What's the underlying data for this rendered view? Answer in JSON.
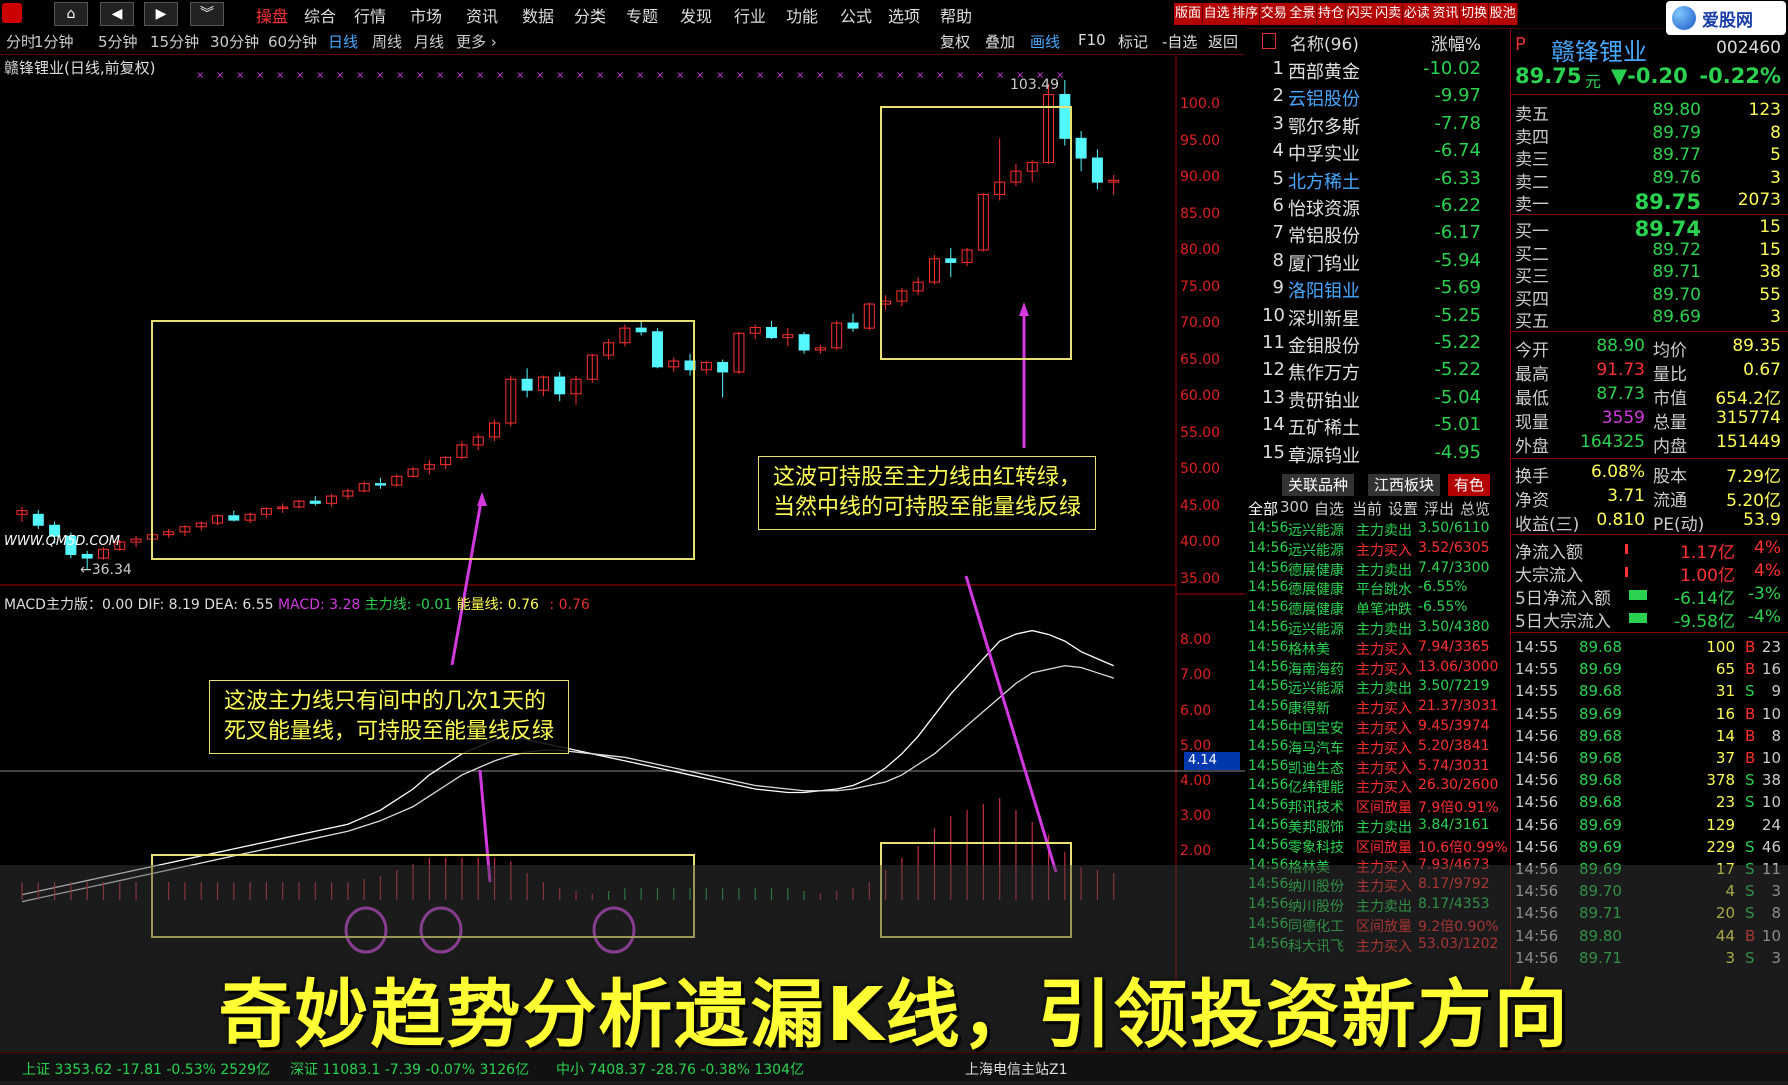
{
  "menubar": {
    "items": [
      "操盘",
      "综合",
      "行情",
      "市场",
      "资讯",
      "数据",
      "分类",
      "专题",
      "发现",
      "行业",
      "功能",
      "公式",
      "选项",
      "帮助"
    ],
    "active": "操盘",
    "right_buttons": [
      "版面",
      "自选",
      "排序",
      "交易",
      "全景",
      "持仓",
      "闪买",
      "闪卖",
      "必读",
      "资讯",
      "切换",
      "股池"
    ],
    "logo": "爱股网"
  },
  "periodbar": {
    "periods": [
      "分时",
      "1分钟",
      "5分钟",
      "15分钟",
      "30分钟",
      "60分钟",
      "日线",
      "周线",
      "月线",
      "更多 ›"
    ],
    "active": "日线",
    "tools": [
      "复权",
      "叠加",
      "画线",
      "F10",
      "标记",
      "-自选",
      "返回"
    ],
    "active_tool": "画线"
  },
  "chart": {
    "title": "赣锋锂业(日线,前复权)",
    "watermark": "WWW.QM5D.COM",
    "high_label": "103.49",
    "low_label": "36.34",
    "price_axis": [
      "100.0",
      "95.00",
      "90.00",
      "85.00",
      "80.00",
      "75.00",
      "70.00",
      "65.00",
      "60.00",
      "55.00",
      "50.00",
      "45.00",
      "40.00",
      "35.00"
    ],
    "macd_axis": [
      "8.00",
      "7.00",
      "6.00",
      "5.00",
      "4.00",
      "3.00",
      "2.00"
    ],
    "cursor_value": "4.14",
    "macd_header": {
      "name": "MACD主力版：0.00",
      "dif": "DIF: 8.19",
      "dea": "DEA: 6.55",
      "macd": "MACD: 3.28",
      "main_line": "主力线: -0.01",
      "energy_line": "能量线: 0.76",
      "extra": ": 0.76"
    },
    "callouts": {
      "right": [
        "这波可持股至主力线由红转绿，",
        "当然中线的可持股至能量线反绿"
      ],
      "left": [
        "这波主力线只有间中的几次1天的",
        "死叉能量线，可持股至能量线反绿"
      ]
    },
    "colors": {
      "up": "#ff3030",
      "down": "#54f6ff",
      "box": "#e8e070",
      "arrow": "#d23ae0"
    }
  },
  "chart_data": {
    "type": "candlestick",
    "title": "赣锋锂业(日线,前复权)",
    "ylim": [
      35,
      103.49
    ],
    "candles": [
      [
        44,
        45,
        43,
        44.5
      ],
      [
        44,
        44.6,
        42,
        42.5
      ],
      [
        42.5,
        43,
        40,
        41
      ],
      [
        41,
        41.5,
        38,
        38.5
      ],
      [
        38.5,
        39,
        36.34,
        38
      ],
      [
        38,
        39.5,
        37.8,
        39.2
      ],
      [
        39.2,
        40.5,
        39,
        40.2
      ],
      [
        40.2,
        41,
        39.5,
        40.6
      ],
      [
        40.6,
        41.5,
        40,
        41.2
      ],
      [
        41.2,
        42,
        40.8,
        41.6
      ],
      [
        41.6,
        42.5,
        41,
        42.3
      ],
      [
        42.3,
        43,
        41.8,
        42.8
      ],
      [
        42.8,
        44,
        42.5,
        43.8
      ],
      [
        43.8,
        44.5,
        43,
        43.2
      ],
      [
        43.2,
        44.2,
        42.8,
        44
      ],
      [
        44,
        45,
        43.5,
        44.8
      ],
      [
        44.8,
        45.5,
        44.2,
        45
      ],
      [
        45,
        46,
        44.8,
        45.8
      ],
      [
        45.8,
        46.5,
        45.2,
        45.5
      ],
      [
        45.5,
        46.8,
        45,
        46.5
      ],
      [
        46.5,
        47.5,
        46,
        47.2
      ],
      [
        47.2,
        48.5,
        47,
        48.2
      ],
      [
        48.2,
        49,
        47.5,
        48
      ],
      [
        48,
        49.5,
        47.8,
        49.2
      ],
      [
        49.2,
        50.5,
        49,
        50.2
      ],
      [
        50.2,
        51.5,
        49.5,
        50.8
      ],
      [
        50.8,
        52,
        50.2,
        51.8
      ],
      [
        51.8,
        54,
        51.5,
        53.5
      ],
      [
        53.5,
        55,
        52.8,
        54.6
      ],
      [
        54.6,
        57,
        54,
        56.5
      ],
      [
        56.5,
        63,
        56,
        62.5
      ],
      [
        62.5,
        64,
        60,
        61
      ],
      [
        61,
        63,
        60.2,
        62.8
      ],
      [
        62.8,
        63.5,
        59.5,
        60.5
      ],
      [
        60.5,
        63,
        59,
        62.5
      ],
      [
        62.5,
        66,
        62,
        65.8
      ],
      [
        65.8,
        68,
        65.2,
        67.5
      ],
      [
        67.5,
        70,
        67,
        69.5
      ],
      [
        69.5,
        70.5,
        68.5,
        69
      ],
      [
        69,
        69.5,
        64,
        64.2
      ],
      [
        64.2,
        65.5,
        63.5,
        65
      ],
      [
        65,
        66,
        63,
        63.8
      ],
      [
        63.8,
        65,
        63.2,
        64.8
      ],
      [
        64.8,
        65.2,
        60,
        63.5
      ],
      [
        63.5,
        69,
        63.2,
        68.8
      ],
      [
        68.8,
        70,
        68,
        69.6
      ],
      [
        69.6,
        70.5,
        68,
        68.2
      ],
      [
        68.2,
        69.5,
        67,
        68.6
      ],
      [
        68.6,
        69,
        66,
        66.5
      ],
      [
        66.5,
        67.2,
        66,
        66.8
      ],
      [
        66.8,
        70.5,
        66.5,
        70.2
      ],
      [
        70.2,
        71.5,
        69,
        69.5
      ],
      [
        69.5,
        73,
        69.2,
        72.8
      ],
      [
        72.8,
        74,
        72,
        73.2
      ],
      [
        73.2,
        75,
        72.5,
        74.6
      ],
      [
        74.6,
        76.5,
        74,
        75.8
      ],
      [
        75.8,
        79.5,
        75.5,
        79
      ],
      [
        79,
        80.5,
        76.5,
        78.5
      ],
      [
        78.5,
        80.5,
        78,
        80.2
      ],
      [
        80.2,
        88,
        80,
        87.8
      ],
      [
        87.8,
        95.5,
        87,
        89.5
      ],
      [
        89.5,
        92,
        89,
        91
      ],
      [
        91,
        92.5,
        89.5,
        92.2
      ],
      [
        92.2,
        103,
        92,
        101.5
      ],
      [
        101.5,
        103.49,
        94.5,
        95.5
      ],
      [
        95.5,
        96.5,
        91,
        92.8
      ],
      [
        92.8,
        94,
        88.5,
        89.5
      ],
      [
        89.5,
        90.5,
        87.73,
        89.75
      ]
    ],
    "dif": [
      0.8,
      0.9,
      1.0,
      1.1,
      1.2,
      1.3,
      1.4,
      1.5,
      1.6,
      1.7,
      1.8,
      1.9,
      2.0,
      2.1,
      2.2,
      2.3,
      2.4,
      2.5,
      2.6,
      2.7,
      2.8,
      3.0,
      3.2,
      3.5,
      3.8,
      4.2,
      4.5,
      4.8,
      5.0,
      5.2,
      5.3,
      5.2,
      5.1,
      5.0,
      4.9,
      4.8,
      4.7,
      4.6,
      4.5,
      4.4,
      4.3,
      4.2,
      4.1,
      4.0,
      3.9,
      3.8,
      3.75,
      3.7,
      3.7,
      3.75,
      3.8,
      3.9,
      4.1,
      4.4,
      4.8,
      5.3,
      5.9,
      6.5,
      7.0,
      7.5,
      8.0,
      8.2,
      8.3,
      8.19,
      8.0,
      7.7,
      7.5,
      7.3
    ],
    "dea": [
      0.6,
      0.7,
      0.8,
      0.9,
      1.0,
      1.1,
      1.2,
      1.3,
      1.4,
      1.5,
      1.6,
      1.7,
      1.8,
      1.9,
      2.0,
      2.1,
      2.2,
      2.3,
      2.4,
      2.5,
      2.6,
      2.75,
      2.9,
      3.1,
      3.3,
      3.6,
      3.9,
      4.2,
      4.4,
      4.6,
      4.75,
      4.85,
      4.9,
      4.9,
      4.85,
      4.8,
      4.75,
      4.7,
      4.6,
      4.5,
      4.4,
      4.3,
      4.2,
      4.1,
      4.0,
      3.9,
      3.85,
      3.8,
      3.75,
      3.75,
      3.75,
      3.8,
      3.9,
      4.0,
      4.2,
      4.5,
      4.8,
      5.2,
      5.6,
      6.0,
      6.4,
      6.8,
      7.1,
      7.2,
      7.3,
      7.25,
      7.1,
      6.95
    ]
  },
  "rank": {
    "header_name": "名称(96)",
    "header_change": "涨幅%",
    "rows": [
      {
        "num": "1",
        "name": "西部黄金",
        "chg": "-10.02"
      },
      {
        "num": "2",
        "name": "云铝股份",
        "chg": "-9.97"
      },
      {
        "num": "3",
        "name": "鄂尔多斯",
        "chg": "-7.78"
      },
      {
        "num": "4",
        "name": "中孚实业",
        "chg": "-6.74"
      },
      {
        "num": "5",
        "name": "北方稀土",
        "chg": "-6.33"
      },
      {
        "num": "6",
        "name": "怡球资源",
        "chg": "-6.22"
      },
      {
        "num": "7",
        "name": "常铝股份",
        "chg": "-6.17"
      },
      {
        "num": "8",
        "name": "厦门钨业",
        "chg": "-5.94"
      },
      {
        "num": "9",
        "name": "洛阳钼业",
        "chg": "-5.69"
      },
      {
        "num": "10",
        "name": "深圳新星",
        "chg": "-5.25"
      },
      {
        "num": "11",
        "name": "金钼股份",
        "chg": "-5.22"
      },
      {
        "num": "12",
        "name": "焦作万方",
        "chg": "-5.22"
      },
      {
        "num": "13",
        "name": "贵研铂业",
        "chg": "-5.04"
      },
      {
        "num": "14",
        "name": "五矿稀土",
        "chg": "-5.01"
      },
      {
        "num": "15",
        "name": "章源钨业",
        "chg": "-4.95"
      }
    ],
    "tabs": [
      "关联品种",
      "江西板块",
      "有色"
    ],
    "filters": [
      "全部",
      "300",
      "自选",
      "当前",
      "设置",
      "浮出",
      "总览"
    ]
  },
  "flow": [
    [
      "14:56",
      "远兴能源",
      "主力卖出",
      "3.50/6110"
    ],
    [
      "14:56",
      "远兴能源",
      "主力买入",
      "3.52/6305"
    ],
    [
      "14:56",
      "德展健康",
      "主力卖出",
      "7.47/3300"
    ],
    [
      "14:56",
      "德展健康",
      "平台跳水",
      "-6.55%"
    ],
    [
      "14:56",
      "德展健康",
      "单笔冲跌",
      "-6.55%"
    ],
    [
      "14:56",
      "远兴能源",
      "主力卖出",
      "3.50/4380"
    ],
    [
      "14:56",
      "格林美",
      "主力买入",
      "7.94/3365"
    ],
    [
      "14:56",
      "海南海药",
      "主力买入",
      "13.06/3000"
    ],
    [
      "14:56",
      "远兴能源",
      "主力卖出",
      "3.50/7219"
    ],
    [
      "14:56",
      "康得新",
      "主力买入",
      "21.37/3031"
    ],
    [
      "14:56",
      "中国宝安",
      "主力买入",
      "9.45/3974"
    ],
    [
      "14:56",
      "海马汽车",
      "主力买入",
      "5.20/3841"
    ],
    [
      "14:56",
      "凯迪生态",
      "主力买入",
      "5.74/3031"
    ],
    [
      "14:56",
      "亿纬锂能",
      "主力买入",
      "26.30/2600"
    ],
    [
      "14:56",
      "邦讯技术",
      "区间放量",
      "7.9倍0.91%"
    ],
    [
      "14:56",
      "美邦服饰",
      "主力卖出",
      "3.84/3161"
    ],
    [
      "14:56",
      "零象科技",
      "区间放量",
      "10.6倍0.99%"
    ],
    [
      "14:56",
      "格林美",
      "主力买入",
      "7.93/4673"
    ],
    [
      "14:56",
      "纳川股份",
      "主力买入",
      "8.17/9792"
    ],
    [
      "14:56",
      "纳川股份",
      "主力卖出",
      "8.17/4353"
    ],
    [
      "14:56",
      "同德化工",
      "区间放量",
      "9.2倍0.90%"
    ],
    [
      "14:56",
      "科大讯飞",
      "主力买入",
      "53.03/1202"
    ]
  ],
  "quote": {
    "flag": "P",
    "name": "赣锋锂业",
    "code": "002460",
    "price": "89.75",
    "unit": "元",
    "change": "▼-0.20",
    "change_pct": "-0.22%",
    "asks": [
      {
        "lbl": "卖五",
        "price": "89.80",
        "vol": "123"
      },
      {
        "lbl": "卖四",
        "price": "89.79",
        "vol": "8"
      },
      {
        "lbl": "卖三",
        "price": "89.77",
        "vol": "5"
      },
      {
        "lbl": "卖二",
        "price": "89.76",
        "vol": "3"
      },
      {
        "lbl": "卖一",
        "price": "89.75",
        "vol": "2073"
      }
    ],
    "bids": [
      {
        "lbl": "买一",
        "price": "89.74",
        "vol": "15"
      },
      {
        "lbl": "买二",
        "price": "89.72",
        "vol": "15"
      },
      {
        "lbl": "买三",
        "price": "89.71",
        "vol": "38"
      },
      {
        "lbl": "买四",
        "price": "89.70",
        "vol": "55"
      },
      {
        "lbl": "买五",
        "price": "89.69",
        "vol": "3"
      }
    ],
    "stats": [
      [
        "今开",
        "88.90",
        "均价",
        "89.35"
      ],
      [
        "最高",
        "91.73",
        "量比",
        "0.67"
      ],
      [
        "最低",
        "87.73",
        "市值",
        "654.2亿"
      ],
      [
        "现量",
        "3559",
        "总量",
        "315774"
      ],
      [
        "外盘",
        "164325",
        "内盘",
        "151449"
      ]
    ],
    "stats2": [
      [
        "换手",
        "6.08%",
        "股本",
        "7.29亿"
      ],
      [
        "净资",
        "3.71",
        "流通",
        "5.20亿"
      ],
      [
        "收益(三)",
        "0.810",
        "PE(动)",
        "53.9"
      ]
    ],
    "flows": [
      [
        "净流入额",
        "1.17亿",
        "4%"
      ],
      [
        "大宗流入",
        "1.00亿",
        "4%"
      ],
      [
        "5日净流入额",
        "-6.14亿",
        "-3%"
      ],
      [
        "5日大宗流入",
        "-9.58亿",
        "-4%"
      ]
    ],
    "trades": [
      [
        "14:55",
        "89.68",
        "100",
        "B",
        "23"
      ],
      [
        "14:55",
        "89.69",
        "65",
        "B",
        "16"
      ],
      [
        "14:55",
        "89.68",
        "31",
        "S",
        "9"
      ],
      [
        "14:55",
        "89.69",
        "16",
        "B",
        "10"
      ],
      [
        "14:56",
        "89.68",
        "14",
        "B",
        "8"
      ],
      [
        "14:56",
        "89.68",
        "37",
        "B",
        "10"
      ],
      [
        "14:56",
        "89.68",
        "378",
        "S",
        "38"
      ],
      [
        "14:56",
        "89.68",
        "23",
        "S",
        "10"
      ],
      [
        "14:56",
        "89.69",
        "129",
        "",
        "24"
      ],
      [
        "14:56",
        "89.69",
        "229",
        "S",
        "46"
      ],
      [
        "14:56",
        "89.69",
        "17",
        "S",
        "11"
      ],
      [
        "14:56",
        "89.70",
        "4",
        "S",
        "3"
      ],
      [
        "14:56",
        "89.71",
        "20",
        "S",
        "8"
      ],
      [
        "14:56",
        "89.80",
        "44",
        "B",
        "10"
      ],
      [
        "14:56",
        "89.71",
        "3",
        "S",
        "3"
      ]
    ]
  },
  "bottombar": {
    "index1": "上证 3353.62  -17.81  -0.53%  2529亿",
    "index2": "深证 11083.1  -7.39  -0.07%  3126亿",
    "index3": "中小 7408.37  -28.76  -0.38%  1304亿",
    "server": "上海电信主站Z1"
  },
  "caption": "奇妙趋势分析遗漏K线，引领投资新方向"
}
